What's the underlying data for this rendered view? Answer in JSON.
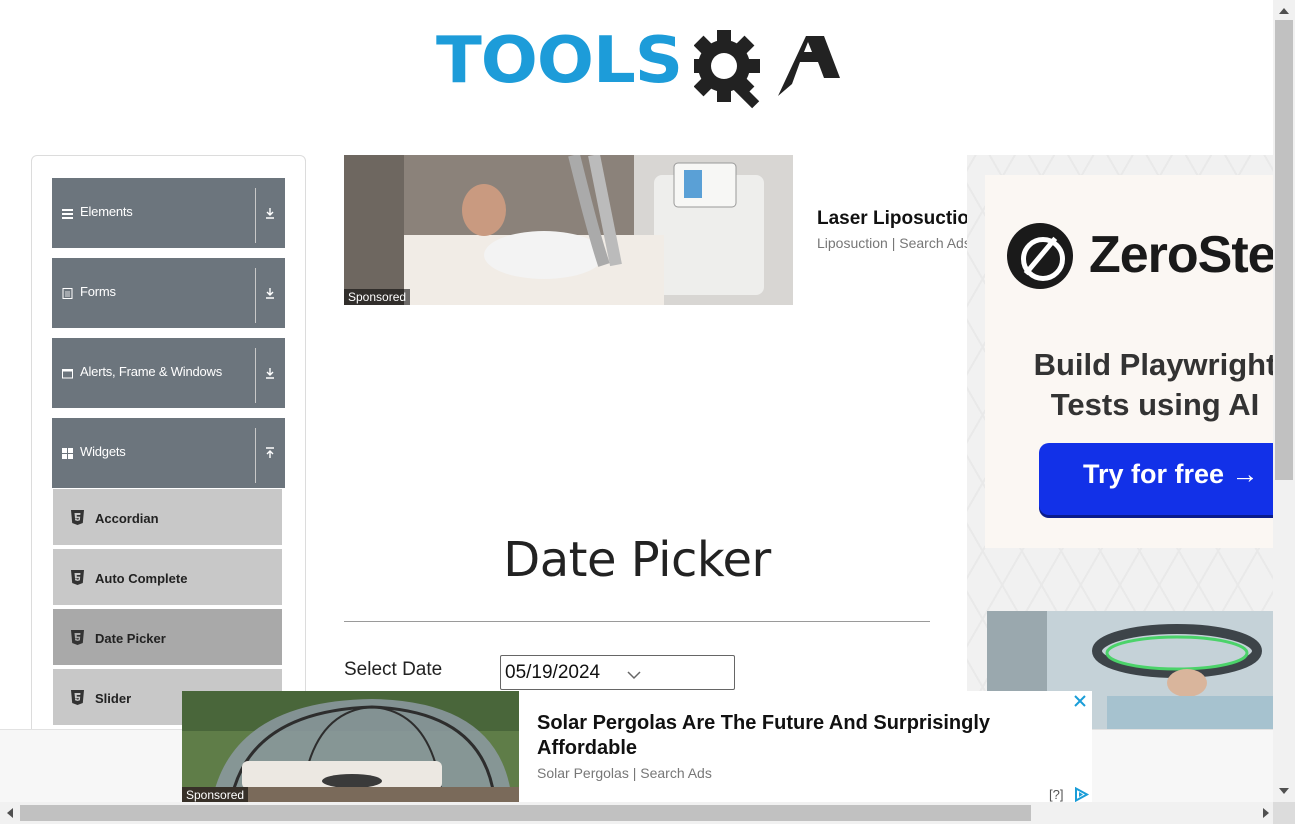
{
  "brand": {
    "logo_text": "TOOLS",
    "logo_suffix": "QA"
  },
  "sidebar": {
    "groups": [
      {
        "label": "Elements",
        "icon": "hamburger-icon",
        "state": "collapsed"
      },
      {
        "label": "Forms",
        "icon": "document-icon",
        "state": "collapsed"
      },
      {
        "label": "Alerts, Frame & Windows",
        "icon": "window-icon",
        "state": "collapsed"
      },
      {
        "label": "Widgets",
        "icon": "grid-icon",
        "state": "expanded"
      }
    ],
    "widget_items": [
      {
        "label": "Accordian",
        "icon": "html5-icon"
      },
      {
        "label": "Auto Complete",
        "icon": "html5-icon"
      },
      {
        "label": "Date Picker",
        "icon": "html5-icon",
        "active": true
      },
      {
        "label": "Slider",
        "icon": "html5-icon"
      }
    ]
  },
  "ads": {
    "top": {
      "sponsored": "Sponsored",
      "title": "Laser Liposuction",
      "subtitle": "Liposuction | Search Ads"
    },
    "right": {
      "brand": "ZeroStep",
      "tagline": "Build Playwright\nTests using AI",
      "cta": "Try for free →"
    },
    "bottom": {
      "sponsored": "Sponsored",
      "title": "Solar Pergolas Are The Future And Surprisingly Affordable",
      "subtitle": "Solar Pergolas | Search Ads",
      "help": "[?]"
    }
  },
  "main": {
    "title": "Date Picker",
    "select_date_label": "Select Date",
    "select_date_value": "05/19/2024"
  },
  "colors": {
    "brand_blue": "#1d9cd9",
    "sidebar_header": "#6c757d",
    "sidebar_item": "#c8c8c8",
    "sidebar_item_active": "#a9a9a9",
    "cta_blue": "#1231e8"
  }
}
